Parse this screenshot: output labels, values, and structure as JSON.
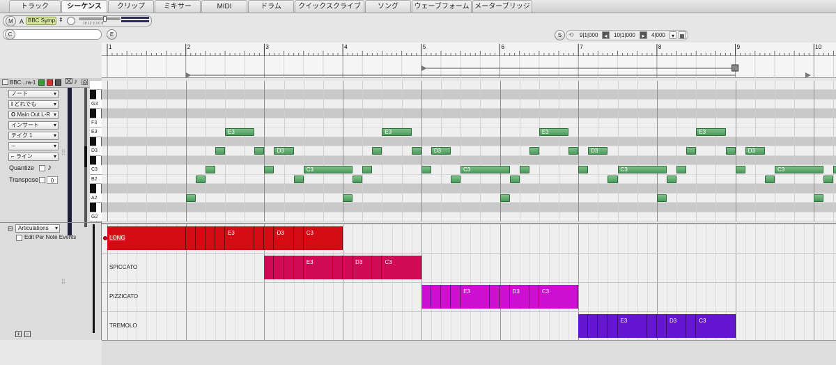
{
  "tabs": [
    "トラック",
    "シーケンス",
    "クリップ",
    "ミキサー",
    "MIDI",
    "ドラム",
    "クイックスクライブ",
    "ソング",
    "ウェーブフォーム",
    "メーターブリッジ"
  ],
  "active_tab": "シーケンス",
  "header": {
    "m_label": "M",
    "a_label": "A",
    "instrument": "BBC Symp...",
    "c_label": "C",
    "e_label": "E",
    "meter_scale": "18  12  3 3 0 8",
    "s_label": "S"
  },
  "transport": {
    "start": "9|1|000",
    "end": "10|1|000",
    "length": "4|000"
  },
  "ruler": {
    "bars": [
      "1",
      "2",
      "3",
      "4",
      "5",
      "6",
      "7",
      "8",
      "9",
      "10"
    ]
  },
  "track": {
    "name": "BBC...ra-1",
    "note_dropdown": "ノート",
    "channel_dropdown": "どれでも",
    "output_dropdown": "Main Out L-R",
    "insert_dropdown": "インサート",
    "take_dropdown": "テイク 1",
    "dash_dropdown": "--",
    "line_dropdown": "ライン",
    "quantize_label": "Quantize",
    "transpose_label": "Transpose",
    "transpose_value": "0"
  },
  "keys": [
    "G3",
    "F3",
    "E3",
    "D3",
    "C3",
    "B2",
    "A2",
    "G2"
  ],
  "notes_pattern": {
    "a2_offset_beats": 0,
    "labels": [
      "E3",
      "D3",
      "C3"
    ]
  },
  "articulation_panel": {
    "dropdown": "Articulations",
    "edit_label": "Edit Per Note Events",
    "lanes": [
      "LONG",
      "SPICCATO",
      "PIZZICATO",
      "TREMOLO"
    ],
    "labels": [
      "E3",
      "D3",
      "C3"
    ],
    "colors": [
      "#d40b14",
      "#d10a55",
      "#cc0fd0",
      "#6415cf"
    ]
  }
}
